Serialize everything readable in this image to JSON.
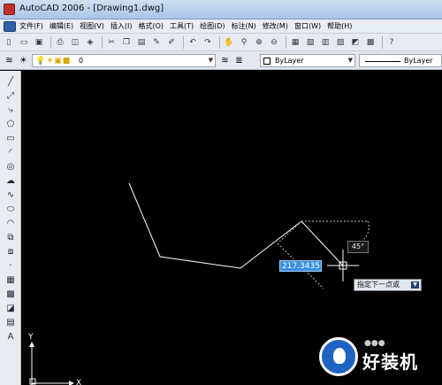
{
  "window": {
    "title": "AutoCAD 2006 - [Drawing1.dwg]"
  },
  "menu": {
    "items": [
      "文件(F)",
      "编辑(E)",
      "视图(V)",
      "插入(I)",
      "格式(O)",
      "工具(T)",
      "绘图(D)",
      "标注(N)",
      "修改(M)",
      "窗口(W)",
      "帮助(H)"
    ]
  },
  "layers": {
    "current_layer": "0"
  },
  "properties": {
    "color": "ByLayer",
    "linetype": "ByLayer"
  },
  "drawing": {
    "dynamic_input_value": "217.3435",
    "angle_value": "45°",
    "command_prompt": "指定下一点或"
  },
  "axes": {
    "y_label": "Y",
    "x_label": "X"
  },
  "watermark": {
    "brand": "好装机",
    "dots": "●●●"
  },
  "colors": {
    "canvas": "#000000",
    "line": "#ffffff",
    "input_highlight": "#3a8fe0"
  }
}
